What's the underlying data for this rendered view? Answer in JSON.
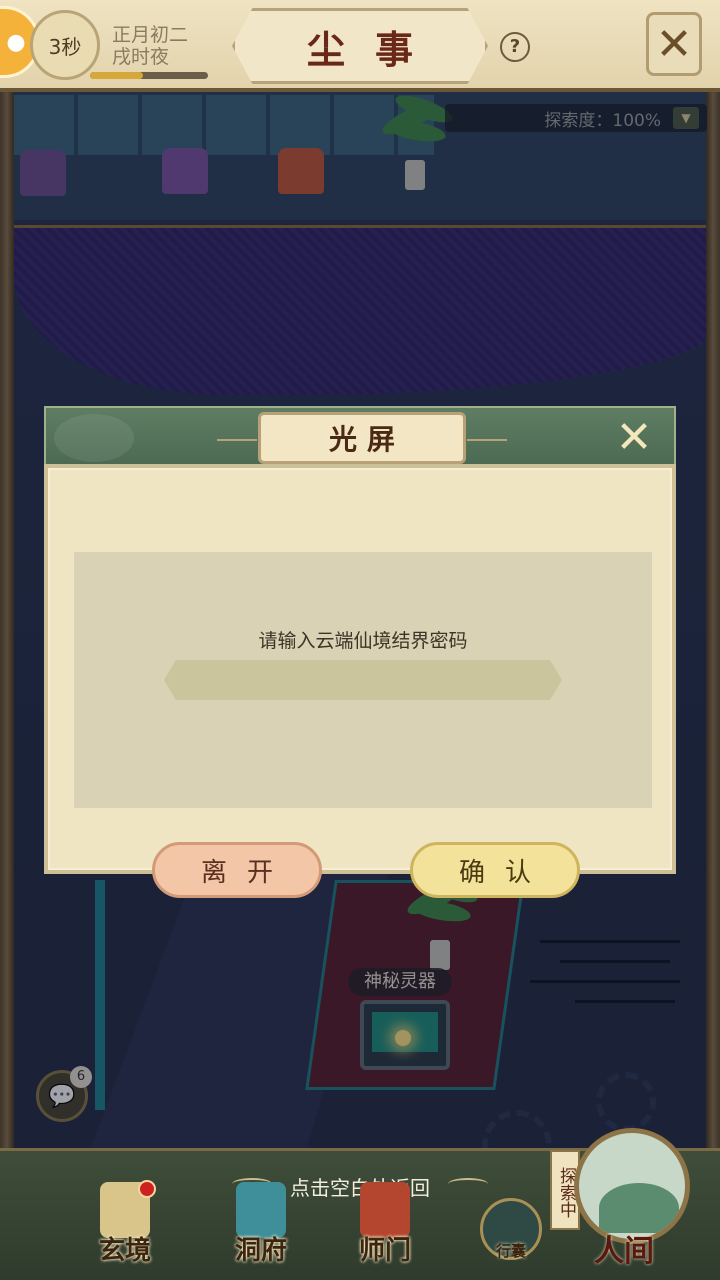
{
  "header": {
    "timer": "3秒",
    "date_line1": "正月初二",
    "date_line2": "戌时夜",
    "time_progress": 0.45,
    "title": "尘事",
    "help_symbol": "?",
    "close_icon": "crossed-swords-icon"
  },
  "scene": {
    "exploration_label": "探索度：100%",
    "mystery_label": "神秘灵器",
    "chat_badge_count": "6"
  },
  "dialog": {
    "title": "光屏",
    "prompt": "请输入云端仙境结界密码",
    "password_value": "",
    "leave_button": "离开",
    "confirm_button": "确认",
    "close_icon": "close-x-icon"
  },
  "bottom": {
    "hint": "点击空白处返回",
    "nav": [
      {
        "label": "玄境",
        "icon": "scroll-icon",
        "has_notification": true
      },
      {
        "label": "洞府",
        "icon": "pavilion-icon"
      },
      {
        "label": "师门",
        "icon": "robe-icon"
      }
    ],
    "bag_label": "行囊",
    "exploring_tag": "探索中",
    "world_label": "人间"
  },
  "colors": {
    "header_bg": "#efe3c2",
    "title_color": "#6a2818",
    "dialog_header": "#5f7d63",
    "dialog_body": "#efe5c3",
    "leave_btn": "#f2c6a6",
    "confirm_btn": "#f3e29a"
  }
}
